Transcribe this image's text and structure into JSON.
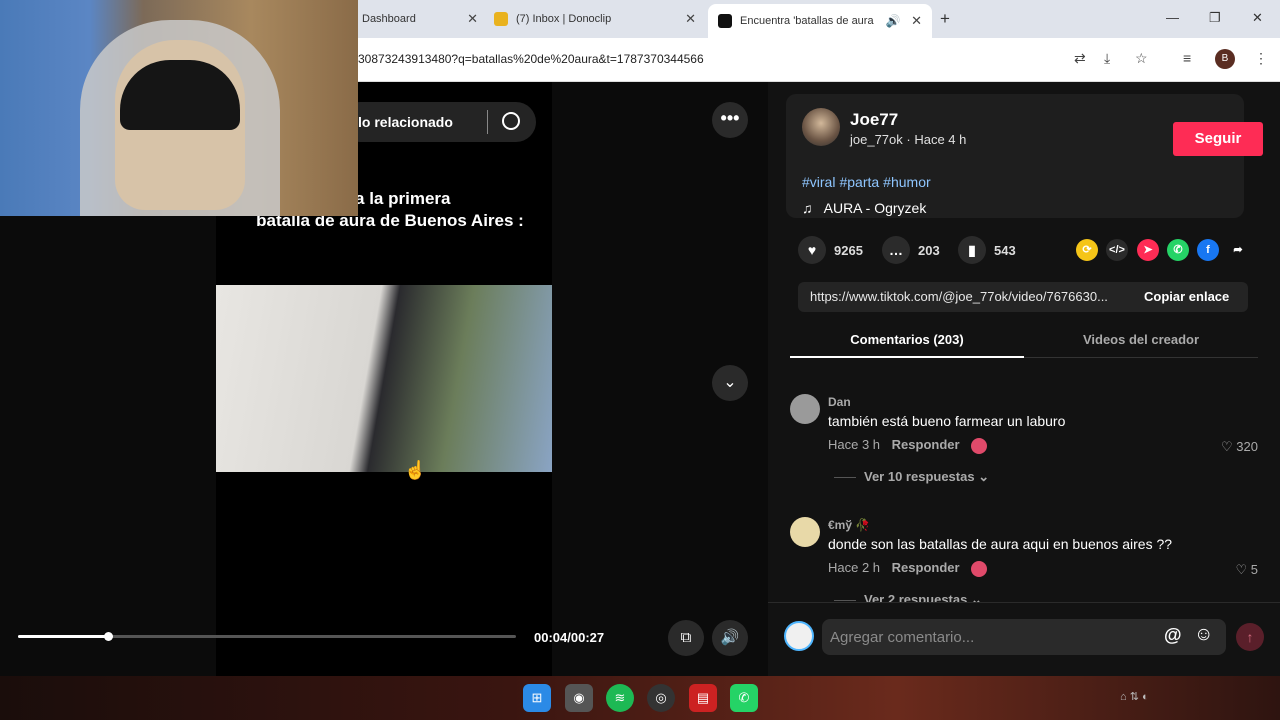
{
  "browser": {
    "tabs": [
      {
        "label": "Dashboard"
      },
      {
        "label": "(7) Inbox | Donoclip"
      },
      {
        "label": "Encuentra 'batallas de aura"
      }
    ],
    "url": "30873243913480?q=batallas%20de%20aura&t=1787370344566",
    "profile_initial": "B"
  },
  "video": {
    "search_label": "lo relacionado",
    "caption_line1": "do a la primera",
    "caption_line2": "batalla de aura de Buenos Aires :",
    "timecode": "00:04/00:27",
    "progress_fraction": 0.18
  },
  "post": {
    "author_name": "Joe77",
    "author_meta": "joe_77ok · Hace 4 h",
    "follow_label": "Seguir",
    "hashtags": [
      "#viral",
      "#parta",
      "#humor"
    ],
    "music": "AURA - Ogryzek",
    "likes": "9265",
    "comments_count": "203",
    "saves": "543",
    "link": "https://www.tiktok.com/@joe_77ok/video/7676630...",
    "copy_label": "Copiar enlace"
  },
  "panel_tabs": [
    {
      "label": "Comentarios (203)"
    },
    {
      "label": "Videos del creador"
    }
  ],
  "comments": [
    {
      "name": "Dan",
      "text": "también está bueno farmear un laburo",
      "time": "Hace 3 h",
      "reply_label": "Responder",
      "likes": "320",
      "more": "Ver 10 respuestas"
    },
    {
      "name": "€mў 🥀",
      "text": "donde son las batallas de aura aqui en buenos aires ??",
      "time": "Hace 2 h",
      "reply_label": "Responder",
      "likes": "5",
      "more": "Ver 2 respuestas"
    }
  ],
  "composer": {
    "placeholder": "Agregar comentario..."
  },
  "colors": {
    "accent": "#fe2c55",
    "hashtag": "#8fc6ff"
  }
}
